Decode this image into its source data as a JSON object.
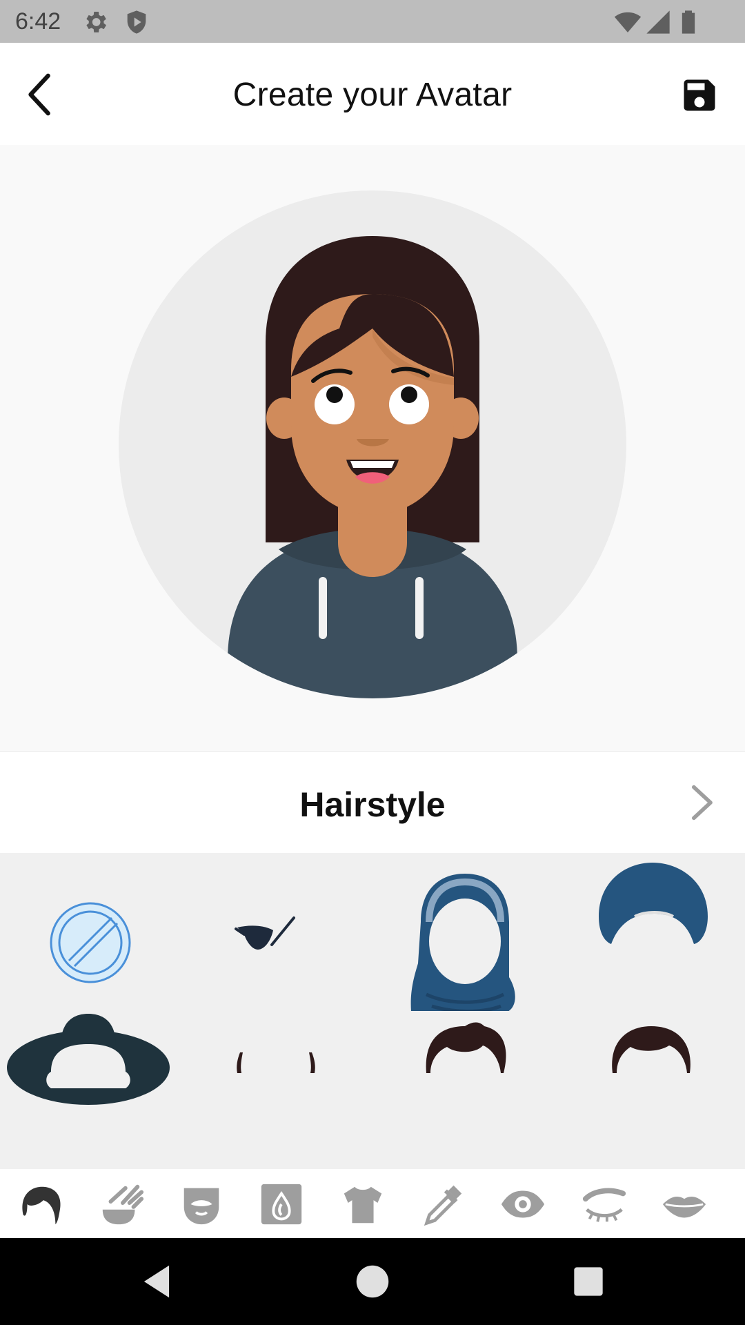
{
  "status_bar": {
    "time": "6:42",
    "icons": [
      "settings-icon",
      "shield-play-icon",
      "wifi-icon",
      "signal-icon",
      "battery-icon"
    ]
  },
  "app_bar": {
    "title": "Create your Avatar",
    "back_icon": "chevron-left-icon",
    "save_icon": "floppy-disk-icon"
  },
  "section": {
    "title": "Hairstyle",
    "next_icon": "chevron-right-icon"
  },
  "options": [
    {
      "name": "none"
    },
    {
      "name": "eyepatch"
    },
    {
      "name": "hijab"
    },
    {
      "name": "turban"
    },
    {
      "name": "wide-brim-hat"
    },
    {
      "name": "sideburns"
    },
    {
      "name": "short-messy-hair"
    },
    {
      "name": "short-hair"
    }
  ],
  "categories": [
    {
      "name": "hair",
      "selected": true
    },
    {
      "name": "hair-color",
      "selected": false
    },
    {
      "name": "facial-hair",
      "selected": false
    },
    {
      "name": "skin-tone",
      "selected": false
    },
    {
      "name": "clothing",
      "selected": false
    },
    {
      "name": "clothing-color",
      "selected": false
    },
    {
      "name": "eyes",
      "selected": false
    },
    {
      "name": "eyebrows",
      "selected": false
    },
    {
      "name": "mouth",
      "selected": false
    }
  ],
  "colors": {
    "skin": "#d08b5b",
    "hair": "#2e1a1a",
    "hoodie": "#3c4f5e",
    "hijab": "#25557f",
    "hat": "#1f333d",
    "none_icon": "#4a90d9",
    "category_selected": "#333333",
    "category_unselected": "#9e9e9e"
  }
}
